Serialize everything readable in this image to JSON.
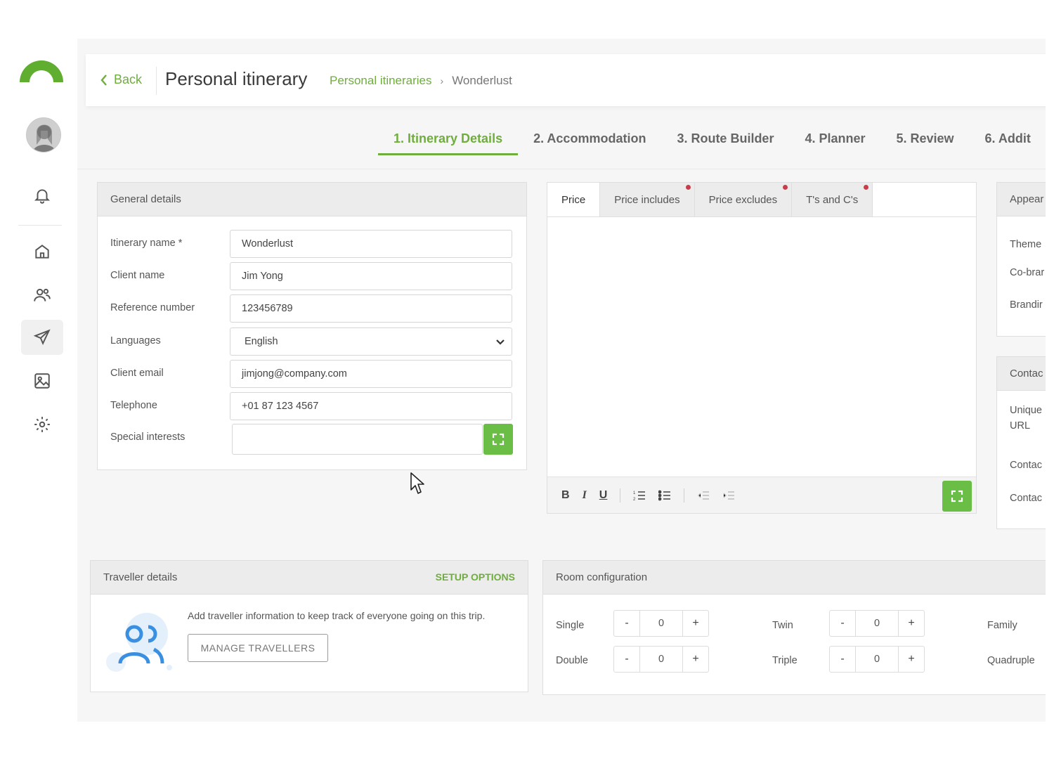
{
  "header": {
    "back_label": "Back",
    "page_title": "Personal itinerary",
    "breadcrumb": {
      "parent": "Personal itineraries",
      "current": "Wonderlust"
    }
  },
  "steps": [
    {
      "label": "1. Itinerary Details",
      "active": true
    },
    {
      "label": "2. Accommodation"
    },
    {
      "label": "3. Route Builder"
    },
    {
      "label": "4. Planner"
    },
    {
      "label": "5. Review"
    },
    {
      "label": "6. Addit"
    }
  ],
  "general": {
    "title": "General details",
    "fields": {
      "itinerary_name": {
        "label": "Itinerary name *",
        "value": "Wonderlust"
      },
      "client_name": {
        "label": "Client name",
        "value": "Jim Yong"
      },
      "reference": {
        "label": "Reference number",
        "value": "123456789"
      },
      "languages": {
        "label": "Languages",
        "value": "English"
      },
      "email": {
        "label": "Client email",
        "value": "jimjong@company.com"
      },
      "telephone": {
        "label": "Telephone",
        "value": "+01 87 123 4567"
      },
      "interests": {
        "label": "Special interests",
        "value": ""
      }
    }
  },
  "price": {
    "tabs": {
      "price": "Price",
      "includes": "Price includes",
      "excludes": "Price excludes",
      "terms": "T's and C's"
    },
    "toolbar": {
      "bold": "B",
      "italic": "I",
      "underline": "U"
    }
  },
  "appearance": {
    "title": "Appear",
    "labels": {
      "theme": "Theme",
      "cobrand": "Co-brar",
      "branding": "Brandir"
    }
  },
  "contact": {
    "title": "Contac",
    "labels": {
      "unique": "Unique",
      "url": "URL",
      "contact1": "Contac",
      "contact2": "Contac"
    }
  },
  "traveller": {
    "title": "Traveller details",
    "setup_label": "SETUP OPTIONS",
    "description": "Add traveller information to keep track of everyone going on this trip.",
    "manage_label": "MANAGE TRAVELLERS"
  },
  "room": {
    "title": "Room configuration",
    "minus": "-",
    "plus": "+",
    "single": {
      "label": "Single",
      "value": "0"
    },
    "double": {
      "label": "Double",
      "value": "0"
    },
    "twin": {
      "label": "Twin",
      "value": "0"
    },
    "triple": {
      "label": "Triple",
      "value": "0"
    },
    "family": {
      "label": "Family"
    },
    "quadruple": {
      "label": "Quadruple"
    }
  },
  "colors": {
    "accent": "#6fae3d",
    "button_green": "#6abd45",
    "alert_dot": "#c93c4a"
  }
}
